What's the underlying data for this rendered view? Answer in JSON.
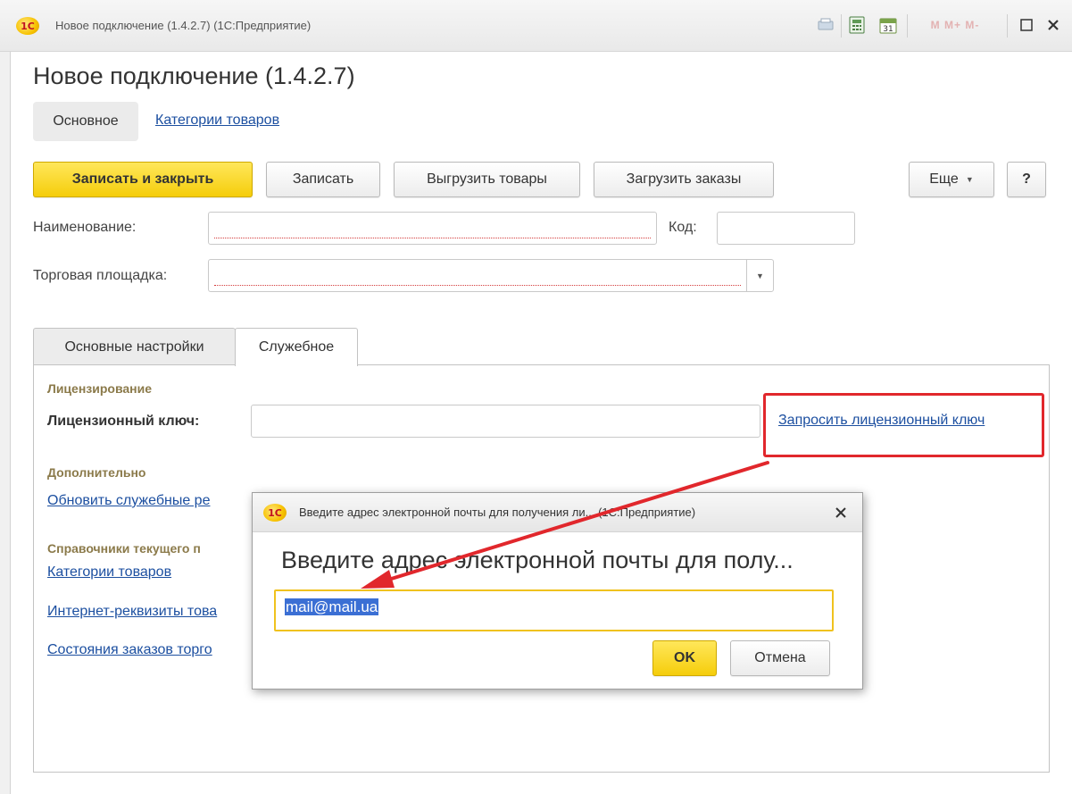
{
  "window": {
    "title": "Новое подключение (1.4.2.7)  (1С:Предприятие)",
    "logo_text": "1С",
    "toolbar_icons": [
      "print-preview-icon",
      "calculator-icon",
      "calendar-icon",
      "memory-buttons-icon",
      "maximize-icon",
      "close-icon"
    ],
    "memory_label": "M  M+  M-",
    "calendar_day": "31"
  },
  "page": {
    "title": "Новое подключение (1.4.2.7)"
  },
  "nav": {
    "main": "Основное",
    "link": "Категории товаров"
  },
  "toolbar": {
    "save_close": "Записать и закрыть",
    "save": "Записать",
    "upload_goods": "Выгрузить товары",
    "load_orders": "Загрузить заказы",
    "more": "Еще",
    "help": "?"
  },
  "form": {
    "name_label": "Наименование:",
    "name_value": "",
    "code_label": "Код:",
    "code_value": "",
    "marketplace_label": "Торговая площадка:",
    "marketplace_value": ""
  },
  "tabs": [
    {
      "label": "Основные настройки",
      "active": false
    },
    {
      "label": "Служебное",
      "active": true
    }
  ],
  "service": {
    "licensing_header": "Лицензирование",
    "license_key_label": "Лицензионный ключ:",
    "license_key_value": "",
    "request_key_link": "Запросить лицензионный ключ",
    "additional_header": "Дополнительно",
    "update_link": "Обновить служебные ре",
    "catalogs_header": "Справочники текущего п",
    "catalog_links": [
      "Категории товаров",
      "Интернет-реквизиты това",
      "Состояния заказов торго"
    ]
  },
  "dialog": {
    "logo_text": "1С",
    "title": "Введите адрес электронной почты для получения ли...  (1С:Предприятие)",
    "heading": "Введите адрес электронной почты для полу...",
    "email_value": "mail@mail.ua",
    "ok": "OK",
    "cancel": "Отмена"
  },
  "colors": {
    "accent_yellow": "#f5cd0b",
    "link_blue": "#1c4fa0",
    "highlight_red": "#e1272c",
    "group_header": "#8b7a4a"
  }
}
